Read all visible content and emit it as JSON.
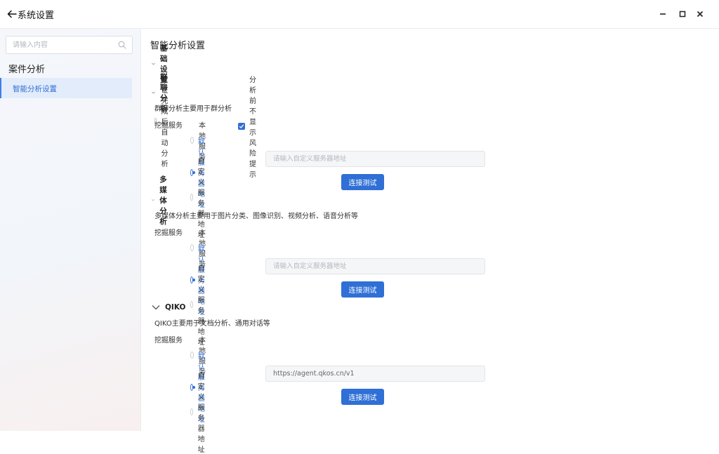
{
  "window": {
    "title": "系统设置",
    "controls": {
      "minimize": "—",
      "maximize": "□",
      "close": "×"
    }
  },
  "sidebar": {
    "search_placeholder": "请输入内容",
    "section_title": "案件分析",
    "items": [
      {
        "label": "智能分析设置",
        "active": true
      }
    ]
  },
  "main": {
    "title": "智能分析设置",
    "basic": {
      "title": "基础设置",
      "checkboxes": [
        {
          "label": "取证完成后自动分析",
          "checked": false
        },
        {
          "label": "分析前不显示风险提示",
          "checked": true
        }
      ]
    },
    "sections": [
      {
        "title": "群聊分析",
        "description": "群聊分析主要用于群分析",
        "service_label": "挖掘服务",
        "options": [
          {
            "label": "本地服务",
            "selected": false
          },
          {
            "label": "默认服务器地址",
            "selected": true
          },
          {
            "label": "自定义服务器地址",
            "selected": false
          }
        ],
        "url_placeholder": "请输入自定义服务器地址",
        "url_value": "",
        "button_label": "连接测试"
      },
      {
        "title": "多媒体分析",
        "description": "多媒体分析主要用于图片分类、图像识别、视频分析、语音分析等",
        "service_label": "挖掘服务",
        "options": [
          {
            "label": "本地服务",
            "selected": false
          },
          {
            "label": "默认服务器地址",
            "selected": true
          },
          {
            "label": "自定义服务器地址",
            "selected": false
          }
        ],
        "url_placeholder": "请输入自定义服务器地址",
        "url_value": "",
        "button_label": "连接测试"
      },
      {
        "title": "QIKO",
        "description": "QIKO主要用于文档分析、通用对话等",
        "service_label": "挖掘服务",
        "options": [
          {
            "label": "本地服务",
            "selected": false
          },
          {
            "label": "默认服务器地址",
            "selected": true
          },
          {
            "label": "自定义服务器地址",
            "selected": false
          }
        ],
        "url_placeholder": "",
        "url_value": "https://agent.qkos.cn/v1",
        "button_label": "连接测试"
      }
    ]
  },
  "colors": {
    "accent": "#2f6fd6",
    "nav_active_bg": "#e3ecfa",
    "input_bg": "#f5f6f8"
  }
}
